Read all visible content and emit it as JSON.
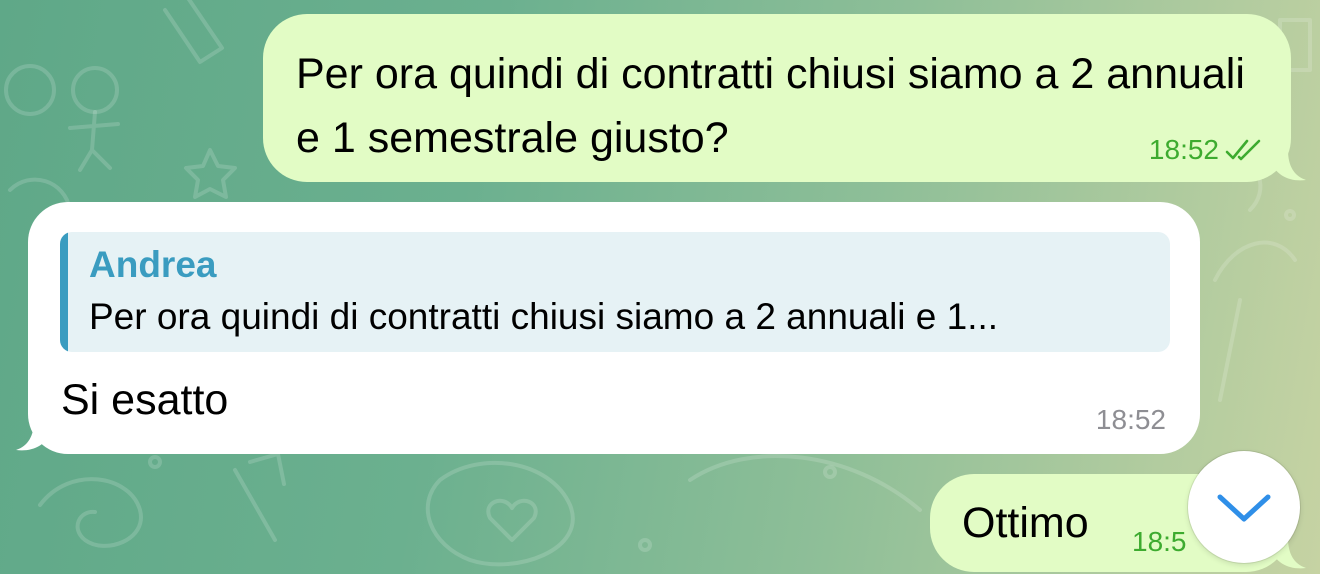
{
  "messages": [
    {
      "direction": "outgoing",
      "text": "Per ora quindi di contratti chiusi siamo a 2 annuali e 1 semestrale giusto?",
      "time": "18:52",
      "status": "read"
    },
    {
      "direction": "incoming",
      "reply": {
        "author": "Andrea",
        "text": "Per ora quindi di contratti chiusi siamo a 2 annuali e 1..."
      },
      "text": "Si esatto",
      "time": "18:52"
    },
    {
      "direction": "outgoing",
      "text": "Ottimo",
      "time": "18:5",
      "status": "read"
    }
  ],
  "scroll_button": {
    "icon": "chevron-down-icon"
  },
  "colors": {
    "outgoing_bubble": "#e2fcc5",
    "incoming_bubble": "#ffffff",
    "check_time_green": "#3dab2f",
    "reply_accent": "#3a9cc0",
    "reply_background": "#e6f2f5",
    "incoming_time": "#8e8e93"
  }
}
